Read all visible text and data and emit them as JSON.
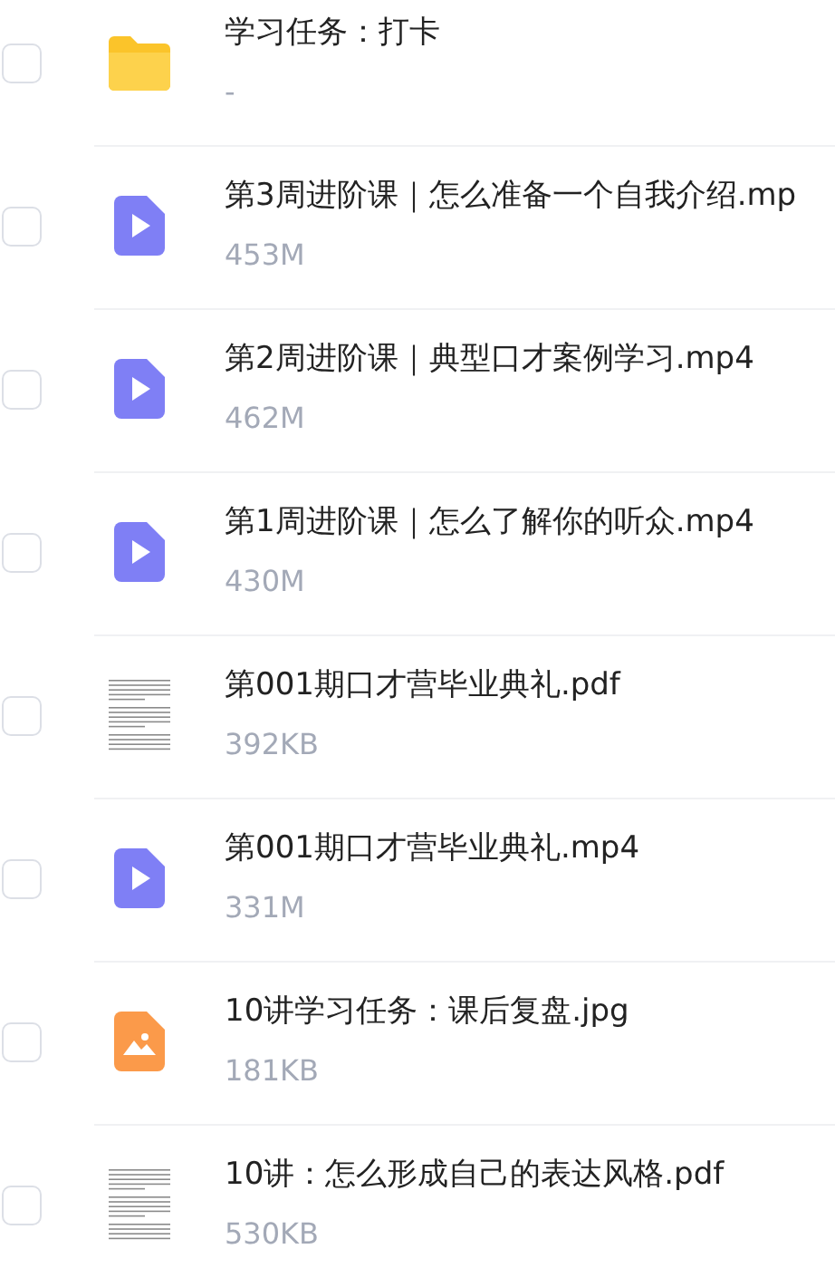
{
  "files": [
    {
      "kind": "folder",
      "name": "学习任务：打卡",
      "size": "-",
      "checked": false
    },
    {
      "kind": "video",
      "name": "第3周进阶课｜怎么准备一个自我介绍.mp",
      "size": "453M",
      "checked": false
    },
    {
      "kind": "video",
      "name": "第2周进阶课｜典型口才案例学习.mp4",
      "size": "462M",
      "checked": false
    },
    {
      "kind": "video",
      "name": "第1周进阶课｜怎么了解你的听众.mp4",
      "size": "430M",
      "checked": false
    },
    {
      "kind": "pdf",
      "name": "第001期口才营毕业典礼.pdf",
      "size": "392KB",
      "checked": false
    },
    {
      "kind": "video",
      "name": "第001期口才营毕业典礼.mp4",
      "size": "331M",
      "checked": false
    },
    {
      "kind": "image",
      "name": "10讲学习任务：课后复盘.jpg",
      "size": "181KB",
      "checked": false
    },
    {
      "kind": "pdf",
      "name": "10讲：怎么形成自己的表达风格.pdf",
      "size": "530KB",
      "checked": false
    }
  ]
}
